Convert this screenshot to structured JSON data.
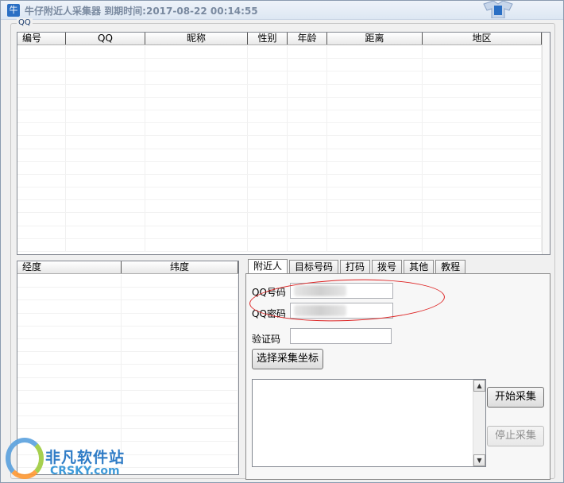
{
  "window": {
    "app_icon": "牛",
    "title": "牛仔附近人采集器  到期时间:2017-08-22 00:14:55"
  },
  "group": {
    "label": "QQ"
  },
  "main_table": {
    "columns": [
      "编号",
      "QQ",
      "昵称",
      "性别",
      "年龄",
      "距离",
      "地区"
    ],
    "rows": []
  },
  "coord_table": {
    "columns": [
      "经度",
      "纬度"
    ],
    "rows": []
  },
  "tabs": [
    "附近人",
    "目标号码",
    "打码",
    "拨号",
    "其他",
    "教程"
  ],
  "active_tab": "附近人",
  "form": {
    "qq_label": "QQ号码",
    "qq_value": "",
    "pwd_label": "QQ密码",
    "pwd_value": "",
    "captcha_label": "验证码",
    "captcha_value": "",
    "select_coord_button": "选择采集坐标"
  },
  "actions": {
    "start_button": "开始采集",
    "stop_button": "停止采集",
    "stop_disabled": true
  },
  "log": {
    "text": ""
  },
  "watermark": {
    "cn": "非凡软件站",
    "en": "CRSKY.com"
  },
  "colors": {
    "title_text": "#7a8aa0",
    "annotation_ellipse": "#dd2222",
    "watermark_blue": "#2f7cc6"
  }
}
